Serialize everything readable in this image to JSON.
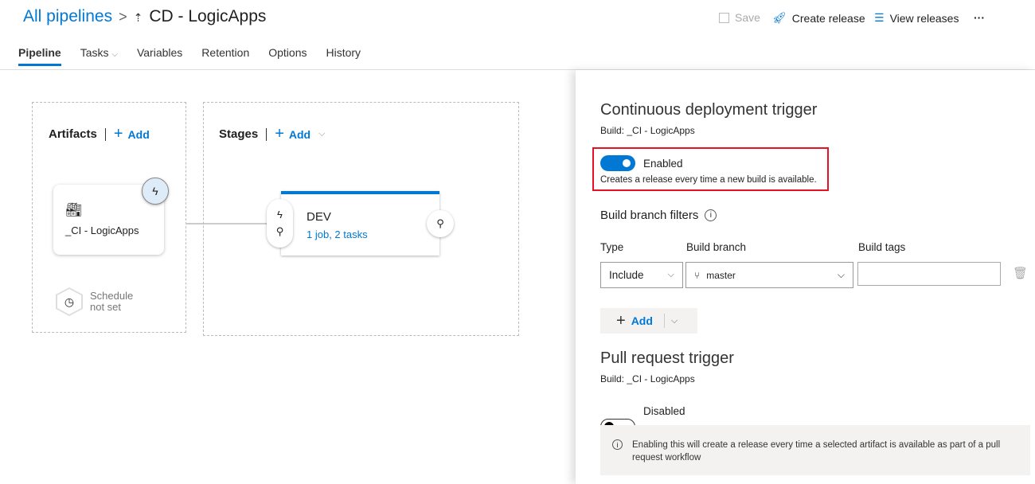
{
  "header": {
    "breadcrumb_root": "All pipelines",
    "title": "CD - LogicApps",
    "save": "Save",
    "create_release": "Create release",
    "view_releases": "View releases",
    "more": "···"
  },
  "tabs": [
    {
      "label": "Pipeline"
    },
    {
      "label": "Tasks"
    },
    {
      "label": "Variables"
    },
    {
      "label": "Retention"
    },
    {
      "label": "Options"
    },
    {
      "label": "History"
    }
  ],
  "artifacts": {
    "heading": "Artifacts",
    "add": "Add",
    "card_name": "_CI - LogicApps",
    "schedule_line1": "Schedule",
    "schedule_line2": "not set"
  },
  "stages": {
    "heading": "Stages",
    "add": "Add",
    "stage_name": "DEV",
    "stage_detail": "1 job, 2 tasks"
  },
  "panel": {
    "cd_title": "Continuous deployment trigger",
    "cd_build": "Build: _CI - LogicApps",
    "cd_toggle_label": "Enabled",
    "cd_toggle_on": true,
    "cd_desc": "Creates a release every time a new build is available.",
    "filters_title": "Build branch filters",
    "col_type": "Type",
    "col_branch": "Build branch",
    "col_tags": "Build tags",
    "type_value": "Include",
    "branch_value": "master",
    "tags_value": "",
    "add": "Add",
    "pr_title": "Pull request trigger",
    "pr_build": "Build: _CI - LogicApps",
    "pr_toggle_label": "Disabled",
    "pr_toggle_on": false,
    "pr_info": "Enabling this will create a release every time a selected artifact is available as part of a pull request workflow"
  },
  "colors": {
    "accent": "#0078d4",
    "highlight": "#e81123"
  }
}
